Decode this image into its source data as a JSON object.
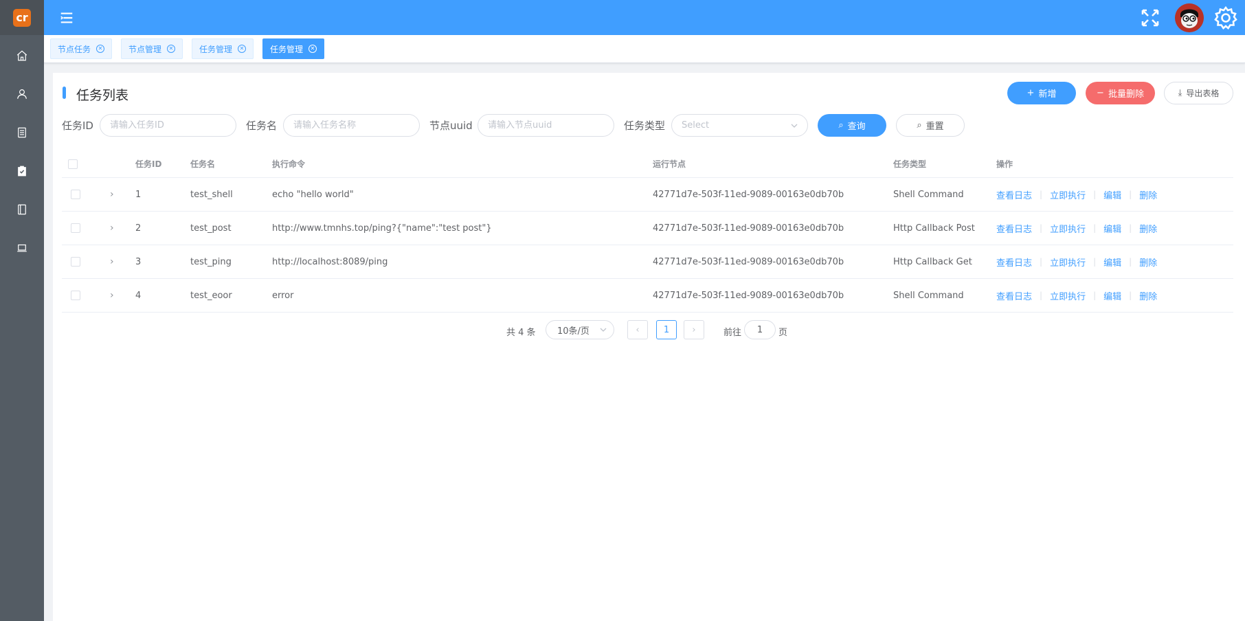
{
  "app": {
    "logo_text": "cr"
  },
  "sidebar": {
    "items": [
      {
        "icon": "home-icon"
      },
      {
        "icon": "user-icon"
      },
      {
        "icon": "document-list-icon"
      },
      {
        "icon": "clipboard-check-icon"
      },
      {
        "icon": "notebook-icon"
      },
      {
        "icon": "laptop-icon"
      }
    ]
  },
  "header": {
    "icons": [
      "hamburger-menu-icon",
      "fullscreen-icon",
      "avatar",
      "settings-gear-icon"
    ]
  },
  "tabs": [
    {
      "label": "节点任务",
      "active": false
    },
    {
      "label": "节点管理",
      "active": false
    },
    {
      "label": "任务管理",
      "active": false
    },
    {
      "label": "任务管理",
      "active": true
    }
  ],
  "card": {
    "title": "任务列表",
    "buttons": {
      "add": "新增",
      "batch_delete": "批量删除",
      "export": "导出表格",
      "query": "查询",
      "reset": "重置"
    }
  },
  "filters": {
    "task_id": {
      "label": "任务ID",
      "placeholder": "请输入任务ID"
    },
    "task_name": {
      "label": "任务名",
      "placeholder": "请输入任务名称"
    },
    "node_uuid": {
      "label": "节点uuid",
      "placeholder": "请输入节点uuid"
    },
    "task_type": {
      "label": "任务类型",
      "placeholder": "Select"
    }
  },
  "table": {
    "columns": [
      "任务ID",
      "任务名",
      "执行命令",
      "运行节点",
      "任务类型",
      "操作"
    ],
    "rows": [
      {
        "id": "1",
        "name": "test_shell",
        "command": "echo \"hello world\"",
        "node": "42771d7e-503f-11ed-9089-00163e0db70b",
        "type": "Shell Command"
      },
      {
        "id": "2",
        "name": "test_post",
        "command": "http://www.tmnhs.top/ping?{\"name\":\"test post\"}",
        "node": "42771d7e-503f-11ed-9089-00163e0db70b",
        "type": "Http Callback Post"
      },
      {
        "id": "3",
        "name": "test_ping",
        "command": "http://localhost:8089/ping",
        "node": "42771d7e-503f-11ed-9089-00163e0db70b",
        "type": "Http Callback Get"
      },
      {
        "id": "4",
        "name": "test_eoor",
        "command": "error",
        "node": "42771d7e-503f-11ed-9089-00163e0db70b",
        "type": "Shell Command"
      }
    ],
    "actions": {
      "view_log": "查看日志",
      "run_now": "立即执行",
      "edit": "编辑",
      "delete": "删除",
      "separator": "|"
    }
  },
  "pagination": {
    "total": "共 4 条",
    "page_size": "10条/页",
    "current_page": "1",
    "goto_label": "前往",
    "goto_value": "1",
    "page_label": "页"
  },
  "colors": {
    "primary": "#409eff",
    "danger": "#f56c6c",
    "sidebar": "#545c64"
  }
}
